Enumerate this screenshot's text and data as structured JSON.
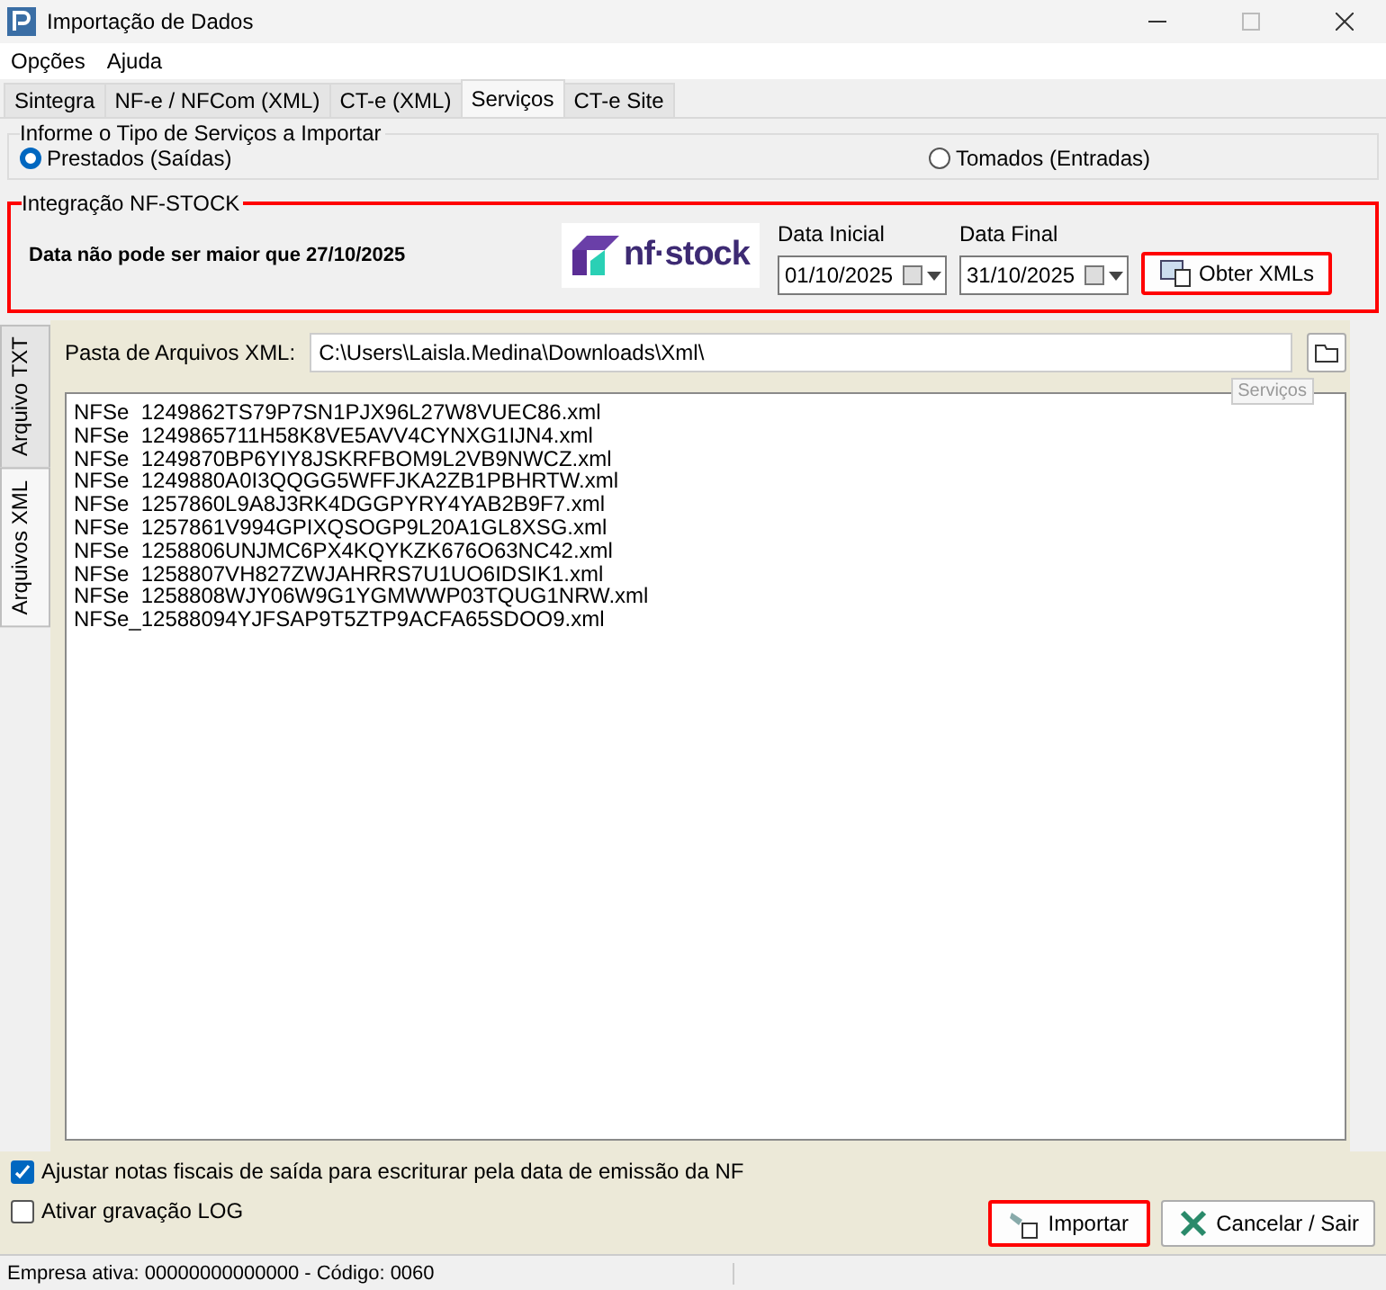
{
  "window": {
    "title": "Importação de Dados"
  },
  "menu": [
    "Opções",
    "Ajuda"
  ],
  "tabs": [
    {
      "label": "Sintegra",
      "selected": false
    },
    {
      "label": "NF-e / NFCom (XML)",
      "selected": false
    },
    {
      "label": "CT-e (XML)",
      "selected": false
    },
    {
      "label": "Serviços",
      "selected": true
    },
    {
      "label": "CT-e Site",
      "selected": false
    }
  ],
  "service_type": {
    "title": "Informe o Tipo de Serviços a Importar",
    "options": [
      {
        "label": "Prestados (Saídas)",
        "selected": true
      },
      {
        "label": "Tomados (Entradas)",
        "selected": false
      }
    ]
  },
  "integration": {
    "title": "Integração NF-STOCK",
    "highlighted": true,
    "warning": "Data não pode ser maior que 27/10/2025",
    "logo_text": "nf·stock",
    "start_date": {
      "label": "Data Inicial",
      "value": "01/10/2025"
    },
    "end_date": {
      "label": "Data Final",
      "value": "31/10/2025"
    },
    "fetch_button": {
      "label": "Obter XMLs",
      "highlighted": true
    }
  },
  "side_tabs": [
    {
      "label": "Arquivo TXT",
      "selected": false
    },
    {
      "label": "Arquivos XML",
      "selected": true
    }
  ],
  "folder": {
    "label": "Pasta de Arquivos XML:",
    "value": "C:\\Users\\Laisla.Medina\\Downloads\\Xml\\",
    "tooltip": "Serviços"
  },
  "files": [
    "NFSe  1249862TS79P7SN1PJX96L27W8VUEC86.xml",
    "NFSe  1249865711H58K8VE5AVV4CYNXG1IJN4.xml",
    "NFSe  1249870BP6YIY8JSKRFBOM9L2VB9NWCZ.xml",
    "NFSe  1249880A0I3QQGG5WFFJKA2ZB1PBHRTW.xml",
    "NFSe  1257860L9A8J3RK4DGGPYRY4YAB2B9F7.xml",
    "NFSe  1257861V994GPIXQSOGP9L20A1GL8XSG.xml",
    "NFSe  1258806UNJMC6PX4KQYKZK676O63NC42.xml",
    "NFSe  1258807VH827ZWJAHRRS7U1UO6IDSIK1.xml",
    "NFSe  1258808WJY06W9G1YGMWWP03TQUG1NRW.xml",
    "NFSe_12588094YJFSAP9T5ZTP9ACFA65SDOO9.xml"
  ],
  "options": [
    {
      "label": "Ajustar notas fiscais de saída para escriturar pela data de emissão da NF",
      "checked": true
    },
    {
      "label": "Ativar gravação LOG",
      "checked": false
    }
  ],
  "buttons": [
    {
      "kind": "import",
      "label": "Importar",
      "highlighted": true
    },
    {
      "kind": "cancel",
      "label": "Cancelar / Sair",
      "highlighted": false
    }
  ],
  "status_bar": "Empresa ativa: 00000000000000 - Código: 0060"
}
